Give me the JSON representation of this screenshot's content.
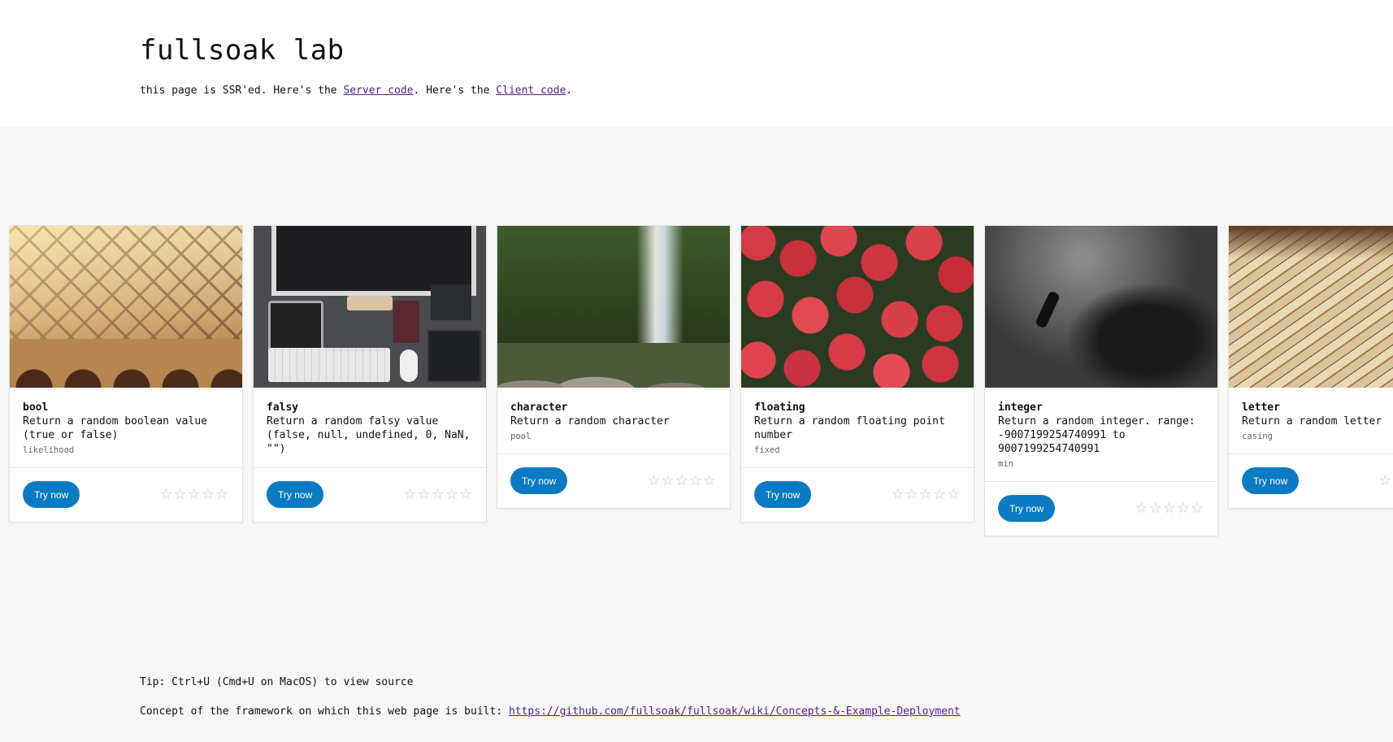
{
  "header": {
    "title": "fullsoak lab",
    "intro_prefix": "this page is SSR'ed. Here's the ",
    "server_link": "Server code",
    "intro_middle": ". Here's the ",
    "client_link": "Client code",
    "intro_suffix": "."
  },
  "cards": [
    {
      "name": "bool",
      "desc": "Return a random boolean value (true or false)",
      "param": "likelihood",
      "button": "Try now",
      "image_icon": "bridge-image",
      "rating": "☆☆☆☆☆"
    },
    {
      "name": "falsy",
      "desc": "Return a random falsy value (false, null, undefined, 0, NaN, \"\")",
      "param": "",
      "button": "Try now",
      "image_icon": "desk-image",
      "rating": "☆☆☆☆☆"
    },
    {
      "name": "character",
      "desc": "Return a random character",
      "param": "pool",
      "button": "Try now",
      "image_icon": "waterfall-image",
      "rating": "☆☆☆☆☆"
    },
    {
      "name": "floating",
      "desc": "Return a random floating point number",
      "param": "fixed",
      "button": "Try now",
      "image_icon": "strawberries-image",
      "rating": "☆☆☆☆☆"
    },
    {
      "name": "integer",
      "desc": "Return a random integer. range: -9007199254740991 to 9007199254740991",
      "param": "min",
      "button": "Try now",
      "image_icon": "diver-image",
      "rating": "☆☆☆☆☆"
    },
    {
      "name": "letter",
      "desc": "Return a random letter",
      "param": "casing",
      "button": "Try now",
      "image_icon": "rulers-image",
      "rating": "☆☆☆☆☆"
    }
  ],
  "footer": {
    "tip": "Tip: Ctrl+U (Cmd+U on MacOS) to view source",
    "concept_prefix": "Concept of the framework on which this web page is built: ",
    "concept_link": "https://github.com/fullsoak/fullsoak/wiki/Concepts-&-Example-Deployment"
  }
}
